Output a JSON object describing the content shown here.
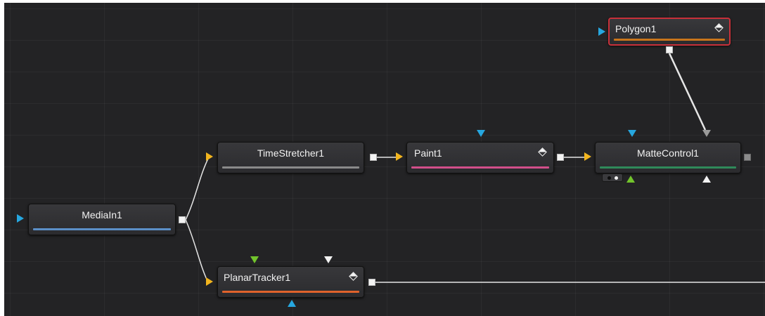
{
  "colors": {
    "background": "#232325",
    "wire": "#e6e6e6",
    "input_orange": "#f2b51e",
    "input_blue": "#26a7e0",
    "input_green": "#72c42c",
    "input_white": "#f2f2f2",
    "input_gray": "#9a9a9a",
    "selected_outline": "#c8303a"
  },
  "nodes": {
    "media_in": {
      "label": "MediaIn1",
      "bar_color": "#5b8fc8"
    },
    "time_stretcher": {
      "label": "TimeStretcher1",
      "bar_color": "#8a8a8a"
    },
    "paint": {
      "label": "Paint1",
      "bar_color": "#d24f8a"
    },
    "matte_control": {
      "label": "MatteControl1",
      "bar_color": "#2f8a5a"
    },
    "polygon": {
      "label": "Polygon1",
      "bar_color": "#c9751b",
      "selected": true
    },
    "planar_tracker": {
      "label": "PlanarTracker1",
      "bar_color": "#e0622b"
    }
  }
}
